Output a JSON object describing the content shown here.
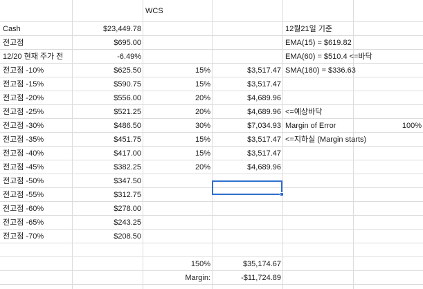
{
  "sheet": {
    "title": "WCS",
    "rows": [
      {
        "a": "Cash",
        "b": "$23,449.78",
        "c": "",
        "d": "",
        "e": "12월21일 기준",
        "f": ""
      },
      {
        "a": "전고점",
        "b": "$695.00",
        "c": "",
        "d": "",
        "e": "EMA(15) = $619.82",
        "f": ""
      },
      {
        "a": "12/20 현재 주가 전",
        "b": "-6.49%",
        "c": "",
        "d": "",
        "e": "EMA(60) = $510.4 <=바닥",
        "f": ""
      },
      {
        "a": "전고점 -10%",
        "b": "$625.50",
        "c": "15%",
        "d": "$3,517.47",
        "e": "SMA(180) = $336.63",
        "f": ""
      },
      {
        "a": "전고점 -15%",
        "b": "$590.75",
        "c": "15%",
        "d": "$3,517.47",
        "e": "",
        "f": ""
      },
      {
        "a": "전고점 -20%",
        "b": "$556.00",
        "c": "20%",
        "d": "$4,689.96",
        "e": "",
        "f": ""
      },
      {
        "a": "전고점 -25%",
        "b": "$521.25",
        "c": "20%",
        "d": "$4,689.96",
        "e": "<=예상바닥",
        "f": ""
      },
      {
        "a": "전고점 -30%",
        "b": "$486.50",
        "c": "30%",
        "d": "$7,034.93",
        "e": "Margin of Error",
        "f": "100%"
      },
      {
        "a": "전고점 -35%",
        "b": "$451.75",
        "c": "15%",
        "d": "$3,517.47",
        "e": "<=지하실 (Margin starts)",
        "f": ""
      },
      {
        "a": "전고점 -40%",
        "b": "$417.00",
        "c": "15%",
        "d": "$3,517.47",
        "e": "",
        "f": ""
      },
      {
        "a": "전고점 -45%",
        "b": "$382.25",
        "c": "20%",
        "d": "$4,689.96",
        "e": "",
        "f": ""
      },
      {
        "a": "전고점 -50%",
        "b": "$347.50",
        "c": "",
        "d": "",
        "e": "",
        "f": ""
      },
      {
        "a": "전고점 -55%",
        "b": "$312.75",
        "c": "",
        "d": "",
        "e": "",
        "f": ""
      },
      {
        "a": "전고점 -60%",
        "b": "$278.00",
        "c": "",
        "d": "",
        "e": "",
        "f": ""
      },
      {
        "a": "전고점 -65%",
        "b": "$243.25",
        "c": "",
        "d": "",
        "e": "",
        "f": ""
      },
      {
        "a": "전고점 -70%",
        "b": "$208.50",
        "c": "",
        "d": "",
        "e": "",
        "f": ""
      },
      {
        "a": "",
        "b": "",
        "c": "",
        "d": "",
        "e": "",
        "f": ""
      },
      {
        "a": "",
        "b": "",
        "c": "150%",
        "d": "$35,174.67",
        "e": "",
        "f": ""
      },
      {
        "a": "",
        "b": "",
        "c": "Margin:",
        "d": "-$11,724.89",
        "e": "",
        "f": ""
      }
    ]
  }
}
